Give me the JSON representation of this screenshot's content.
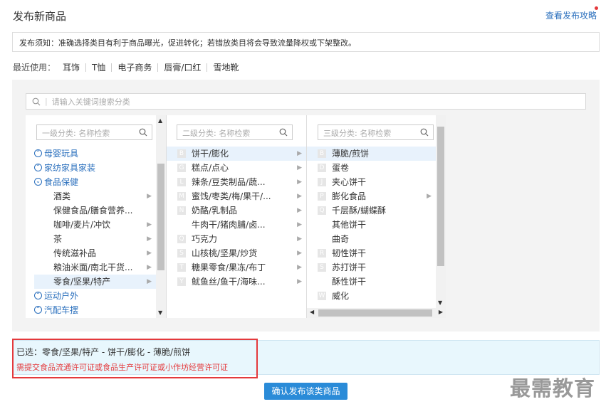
{
  "page": {
    "title": "发布新商品",
    "guide_link": "查看发布攻略"
  },
  "notice": "发布须知：准确选择类目有利于商品曝光，促进转化；若错放类目将会导致流量降权或下架整改。",
  "recent": {
    "label": "最近使用：",
    "items": [
      "耳饰",
      "T恤",
      "电子商务",
      "唇膏/口红",
      "雪地靴"
    ]
  },
  "search": {
    "placeholder": "请输入关键词搜索分类"
  },
  "col1": {
    "placeholder": "一级分类: 名称检索",
    "items": [
      {
        "label": "母婴玩具",
        "type": "cat"
      },
      {
        "label": "家纺家具家装",
        "type": "cat"
      },
      {
        "label": "食品保健",
        "type": "cat",
        "open": true
      },
      {
        "label": "酒类",
        "type": "sub",
        "arrow": true
      },
      {
        "label": "保健食品/膳食营养...",
        "type": "sub",
        "arrow": false
      },
      {
        "label": "咖啡/麦片/冲饮",
        "type": "sub",
        "arrow": true
      },
      {
        "label": "茶",
        "type": "sub",
        "arrow": true
      },
      {
        "label": "传统滋补品",
        "type": "sub",
        "arrow": true
      },
      {
        "label": "粮油米面/南北干货...",
        "type": "sub",
        "arrow": true
      },
      {
        "label": "零食/坚果/特产",
        "type": "sub",
        "arrow": true,
        "selected": true
      },
      {
        "label": "运动户外",
        "type": "cat"
      },
      {
        "label": "汽配车摆",
        "type": "cat"
      }
    ]
  },
  "col2": {
    "placeholder": "二级分类: 名称检索",
    "items": [
      {
        "letter": "B",
        "label": "饼干/膨化",
        "arrow": true,
        "selected": true
      },
      {
        "letter": "G",
        "label": "糕点/点心",
        "arrow": true
      },
      {
        "letter": "L",
        "label": "辣条/豆类制品/蔬...",
        "arrow": true
      },
      {
        "letter": "M",
        "label": "蜜饯/枣类/梅/果干/...",
        "arrow": true
      },
      {
        "letter": "N",
        "label": "奶酪/乳制品",
        "arrow": true
      },
      {
        "letter": "",
        "label": "牛肉干/猪肉脯/卤...",
        "arrow": true
      },
      {
        "letter": "Q",
        "label": "巧克力",
        "arrow": true
      },
      {
        "letter": "S",
        "label": "山核桃/坚果/炒货",
        "arrow": true
      },
      {
        "letter": "T",
        "label": "糖果零食/果冻/布丁",
        "arrow": true
      },
      {
        "letter": "Y",
        "label": "鱿鱼丝/鱼干/海味...",
        "arrow": true
      }
    ]
  },
  "col3": {
    "placeholder": "三级分类: 名称检索",
    "items": [
      {
        "letter": "B",
        "label": "薄脆/煎饼",
        "selected": true
      },
      {
        "letter": "D",
        "label": "蛋卷"
      },
      {
        "letter": "J",
        "label": "夹心饼干"
      },
      {
        "letter": "P",
        "label": "膨化食品",
        "arrow": true
      },
      {
        "letter": "Q",
        "label": "千层酥/蝴蝶酥"
      },
      {
        "letter": "",
        "label": "其他饼干"
      },
      {
        "letter": "",
        "label": "曲奇"
      },
      {
        "letter": "R",
        "label": "韧性饼干"
      },
      {
        "letter": "S",
        "label": "苏打饼干"
      },
      {
        "letter": "",
        "label": "酥性饼干"
      },
      {
        "letter": "W",
        "label": "威化"
      }
    ]
  },
  "selection": {
    "path": "已选：零食/坚果/特产 - 饼干/膨化 - 薄脆/煎饼",
    "warning": "需提交食品流通许可证或食品生产许可证或小作坊经营许可证"
  },
  "confirm_label": "确认发布该类商品",
  "watermark": "最需教育",
  "colors": {
    "accent": "#2a8bd8",
    "link": "#2a6fbd",
    "warning": "#e4393c"
  }
}
